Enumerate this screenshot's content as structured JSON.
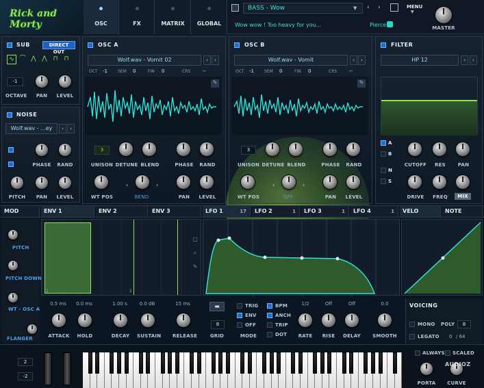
{
  "brand": {
    "logo": "Rick and Morty"
  },
  "top_tabs": [
    {
      "label": "OSC"
    },
    {
      "label": "FX"
    },
    {
      "label": "MATRIX"
    },
    {
      "label": "GLOBAL"
    }
  ],
  "preset": {
    "name": "BASS - Wow",
    "message": "Wow wow ! Too heavy for you...",
    "author": "Pierce",
    "menu_label": "MENU",
    "master_label": "MASTER"
  },
  "sub": {
    "title": "SUB",
    "direct_out": "DIRECT OUT",
    "octave_value": "-1",
    "octave_label": "OCTAVE",
    "pan_label": "PAN",
    "level_label": "LEVEL"
  },
  "noise": {
    "title": "NOISE",
    "wave": "Wolf.wav - ...ey",
    "phase_label": "PHASE",
    "rand_label": "RAND",
    "pitch_label": "PITCH",
    "pan_label": "PAN",
    "level_label": "LEVEL"
  },
  "osc_a": {
    "title": "OSC A",
    "wave": "Wolf.wav - Vomit 02",
    "oct_label": "OCT",
    "oct": "-1",
    "sem_label": "SEM",
    "sem": "0",
    "fin_label": "FIN",
    "fin": "0",
    "crs_label": "CRS",
    "crs": "--",
    "unison": "3",
    "unison_label": "UNISON",
    "detune_label": "DETUNE",
    "blend_label": "BLEND",
    "phase_label": "PHASE",
    "rand_label": "RAND",
    "wtpos_label": "WT POS",
    "bend_label": "BEND",
    "pan_label": "PAN",
    "level_label": "LEVEL"
  },
  "osc_b": {
    "title": "OSC B",
    "wave": "Wolf.wav - Vomit",
    "oct_label": "OCT",
    "oct": "-1",
    "sem_label": "SEM",
    "sem": "0",
    "fin_label": "FIN",
    "fin": "0",
    "crs_label": "CRS",
    "crs": "--",
    "unison": "3",
    "unison_label": "UNISON",
    "detune_label": "DETUNE",
    "blend_label": "BLEND",
    "phase_label": "PHASE",
    "rand_label": "RAND",
    "wtpos_label": "WT POS",
    "off_label": "OFF",
    "pan_label": "PAN",
    "level_label": "LEVEL"
  },
  "filter": {
    "title": "FILTER",
    "type": "HP 12",
    "routes": [
      "A",
      "B",
      "N",
      "S"
    ],
    "cutoff_label": "CUTOFF",
    "res_label": "RES",
    "pan_label": "PAN",
    "drive_label": "DRIVE",
    "freq_label": "FREQ",
    "mix_label": "MIX"
  },
  "mod_tabs": {
    "mod": "MOD",
    "env1": "ENV 1",
    "env2": "ENV 2",
    "env3": "ENV 3",
    "lfo1": "LFO 1",
    "lfo1_n": "17",
    "lfo2": "LFO 2",
    "lfo2_n": "1",
    "lfo3": "LFO 3",
    "lfo3_n": "1",
    "lfo4": "LFO 4",
    "lfo4_n": "1",
    "velo": "VELO",
    "note": "NOTE"
  },
  "mod_sources": [
    {
      "label": "PITCH"
    },
    {
      "label": "PITCH DOWN"
    },
    {
      "label": "WT - OSC A"
    },
    {
      "label": "FLANGER"
    }
  ],
  "env": {
    "attack": "0.5 ms",
    "hold": "0.0 ms",
    "decay": "1.00 s",
    "sustain": "0.0 dB",
    "release": "15 ms",
    "attack_label": "ATTACK",
    "hold_label": "HOLD",
    "decay_label": "DECAY",
    "sustain_label": "SUSTAIN",
    "release_label": "RELEASE",
    "marker1": "1",
    "marker2": "2"
  },
  "lfo": {
    "grid": "8",
    "grid_label": "GRID",
    "mode_label": "MODE",
    "trig": "TRIG",
    "env": "ENV",
    "off": "OFF",
    "bpm": "BPM",
    "anch": "ANCH",
    "trip": "TRIP",
    "dot": "DOT",
    "rate": "1/2",
    "rise": "Off",
    "delay": "Off",
    "smooth": "0.0",
    "rate_label": "RATE",
    "rise_label": "RISE",
    "delay_label": "DELAY",
    "smooth_label": "SMOOTH"
  },
  "voicing": {
    "title": "VOICING",
    "mono": "MONO",
    "poly_label": "POLY",
    "poly": "8",
    "legato": "LEGATO",
    "count": "0",
    "max": "/ 64",
    "always": "ALWAYS",
    "scaled": "SCALED",
    "porta": "PORTA",
    "curve": "CURVE"
  },
  "keyboard": {
    "pitch_up": "2",
    "pitch_down": "-2"
  },
  "watermark": "AUDIOZ"
}
